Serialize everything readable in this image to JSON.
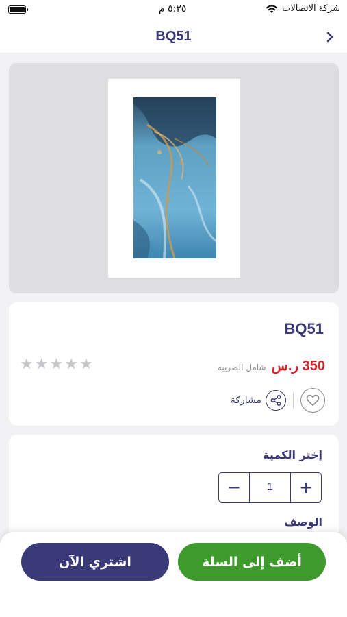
{
  "status_bar": {
    "carrier": "شركة الاتصالات",
    "time": "٥:٢٥ م"
  },
  "nav": {
    "title": "BQ51",
    "back_icon": "chevron-right-icon"
  },
  "product": {
    "name": "BQ51",
    "price": "350 ر.س",
    "price_note": "شامل الضريبه",
    "rating": 0,
    "rating_max": 5,
    "share_label": "مشاركة",
    "favorite_icon": "heart-icon",
    "share_icon": "share-icon"
  },
  "quantity": {
    "label": "إختر الكمية",
    "value": "1",
    "minus": "−",
    "plus": "+"
  },
  "description": {
    "label": "الوصف"
  },
  "actions": {
    "add_to_cart": "أضف إلى السلة",
    "buy_now": "اشتري الآن"
  },
  "colors": {
    "primary": "#3a3a78",
    "accent_green": "#3f9a2e",
    "price_red": "#d8232a",
    "star_empty": "#c6c6c8"
  }
}
